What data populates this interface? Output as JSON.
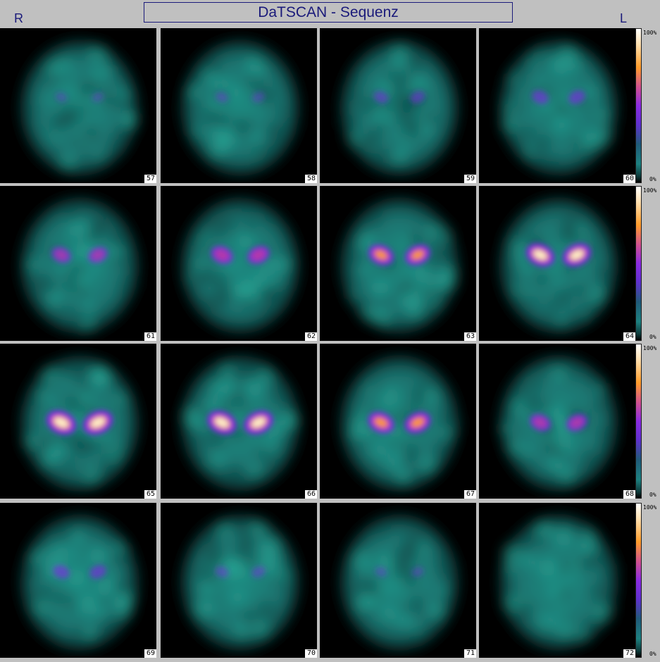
{
  "header": {
    "title": "DaTSCAN - Sequenz",
    "left_side_label": "R",
    "right_side_label": "L"
  },
  "colorbar": {
    "top_label": "100%",
    "bottom_label": "0%",
    "colors": [
      "#ffffff",
      "#ff9c2a",
      "#8a2be2",
      "#1d8080",
      "#000000"
    ]
  },
  "slices": [
    {
      "number": "57",
      "uptake": 0.03
    },
    {
      "number": "58",
      "uptake": 0.08
    },
    {
      "number": "59",
      "uptake": 0.2
    },
    {
      "number": "60",
      "uptake": 0.3
    },
    {
      "number": "61",
      "uptake": 0.45
    },
    {
      "number": "62",
      "uptake": 0.58
    },
    {
      "number": "63",
      "uptake": 0.75
    },
    {
      "number": "64",
      "uptake": 0.92
    },
    {
      "number": "65",
      "uptake": 1.0
    },
    {
      "number": "66",
      "uptake": 0.96
    },
    {
      "number": "67",
      "uptake": 0.8
    },
    {
      "number": "68",
      "uptake": 0.52
    },
    {
      "number": "69",
      "uptake": 0.3
    },
    {
      "number": "70",
      "uptake": 0.14
    },
    {
      "number": "71",
      "uptake": 0.05
    },
    {
      "number": "72",
      "uptake": 0.02
    }
  ]
}
